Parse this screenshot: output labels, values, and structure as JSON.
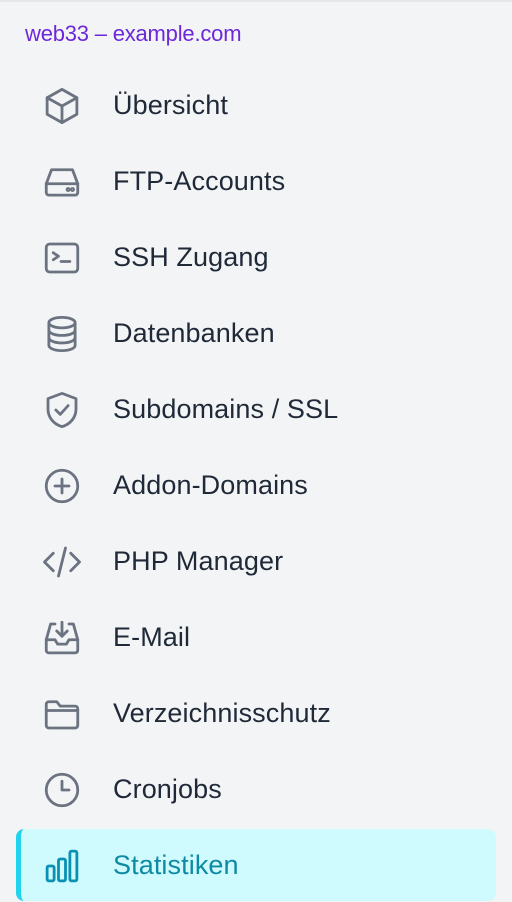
{
  "header": {
    "site": "web33 – example.com"
  },
  "nav": {
    "items": [
      {
        "label": "Übersicht",
        "icon": "cube-icon"
      },
      {
        "label": "FTP-Accounts",
        "icon": "hard-drive-icon"
      },
      {
        "label": "SSH Zugang",
        "icon": "terminal-icon"
      },
      {
        "label": "Datenbanken",
        "icon": "database-icon"
      },
      {
        "label": "Subdomains / SSL",
        "icon": "shield-check-icon"
      },
      {
        "label": "Addon-Domains",
        "icon": "plus-circle-icon"
      },
      {
        "label": "PHP Manager",
        "icon": "code-icon"
      },
      {
        "label": "E-Mail",
        "icon": "inbox-download-icon"
      },
      {
        "label": "Verzeichnisschutz",
        "icon": "folder-icon"
      },
      {
        "label": "Cronjobs",
        "icon": "clock-icon"
      },
      {
        "label": "Statistiken",
        "icon": "bar-chart-icon",
        "active": true
      }
    ]
  },
  "colors": {
    "background": "#f3f4f6",
    "site_title": "#6d28d9",
    "active_background": "#cffafe",
    "active_border": "#22d3ee",
    "active_text": "#0e8aa3"
  }
}
